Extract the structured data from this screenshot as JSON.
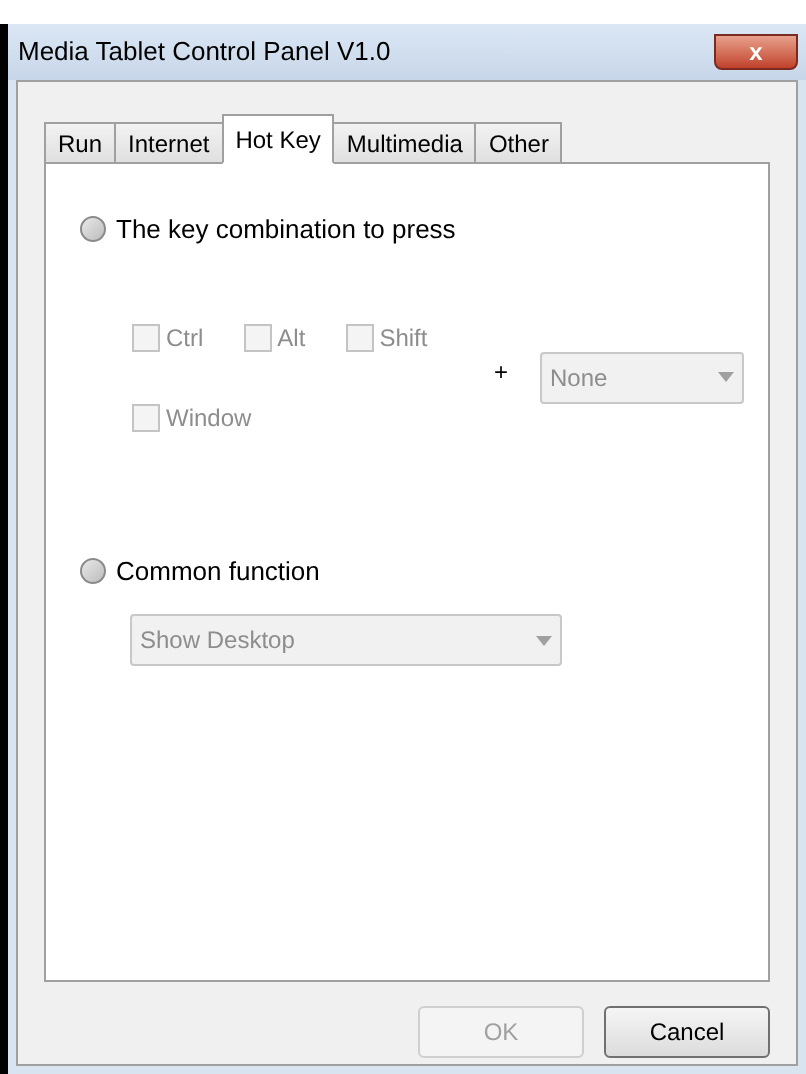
{
  "window": {
    "title": "Media Tablet Control Panel V1.0",
    "close_label": "x"
  },
  "tabs": [
    {
      "label": "Run",
      "selected": false
    },
    {
      "label": "Internet",
      "selected": false
    },
    {
      "label": "Hot Key",
      "selected": true
    },
    {
      "label": "Multimedia",
      "selected": false
    },
    {
      "label": "Other",
      "selected": false
    }
  ],
  "key_combination": {
    "label": "The key combination to press",
    "selected": false,
    "modifiers": [
      {
        "label": "Ctrl",
        "checked": false
      },
      {
        "label": "Alt",
        "checked": false
      },
      {
        "label": "Shift",
        "checked": false
      },
      {
        "label": "Window",
        "checked": false
      }
    ],
    "plus": "+",
    "key": {
      "value": "None",
      "disabled": true
    }
  },
  "common_function": {
    "label": "Common function",
    "selected": false,
    "function": {
      "value": "Show Desktop",
      "disabled": true
    }
  },
  "buttons": [
    {
      "label": "OK",
      "disabled": true
    },
    {
      "label": "Cancel",
      "disabled": false
    }
  ]
}
